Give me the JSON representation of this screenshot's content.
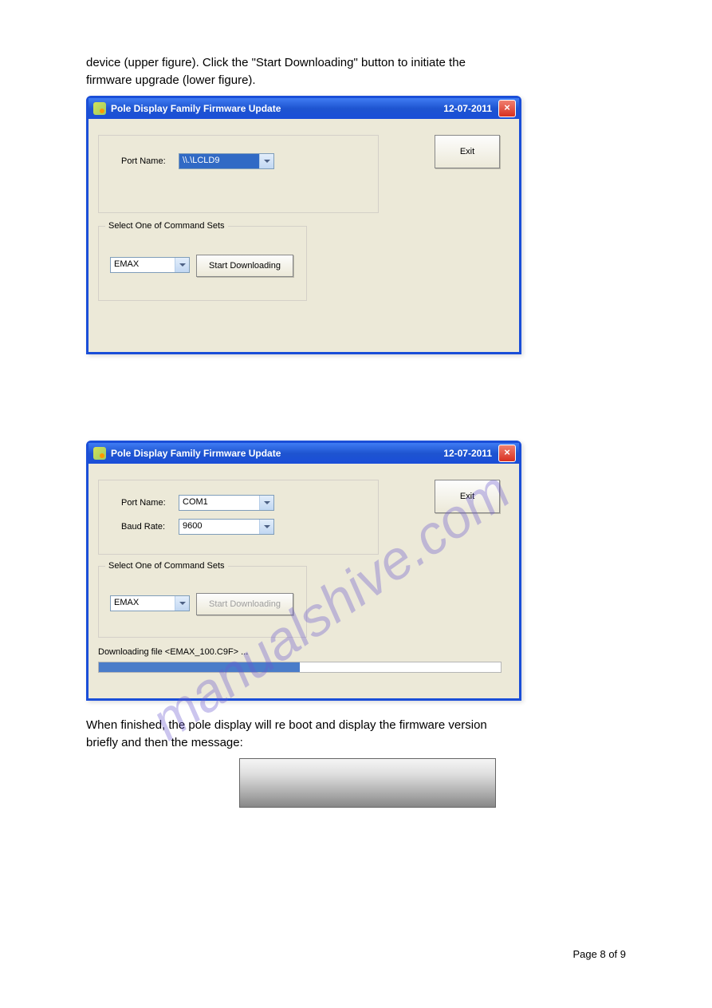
{
  "doc": {
    "intro1": "device (upper figure). Click the \"Start Downloading\" button to initiate the",
    "intro2": "firmware upgrade (lower figure).",
    "mid1": "When finished, the pole display will re boot and display the firmware version",
    "mid2": "briefly and then the message:"
  },
  "dialog1": {
    "title": "Pole Display Family Firmware Update",
    "date": "12-07-2011",
    "port_label": "Port Name:",
    "port_value": "\\\\.\\LCLD9",
    "group_label": "Select One of Command Sets",
    "command_value": "EMAX",
    "start_button": "Start Downloading",
    "exit_button": "Exit"
  },
  "dialog2": {
    "title": "Pole Display Family Firmware Update",
    "date": "12-07-2011",
    "port_label": "Port Name:",
    "port_value": "COM1",
    "baud_label": "Baud Rate:",
    "baud_value": "9600",
    "group_label": "Select One of Command Sets",
    "command_value": "EMAX",
    "start_button": "Start Downloading",
    "exit_button": "Exit",
    "status": "Downloading file <EMAX_100.C9F> ...",
    "progress_percent": 50
  },
  "watermark": "manualshive.com",
  "footer": {
    "page_label": "Page 8 of 9"
  }
}
